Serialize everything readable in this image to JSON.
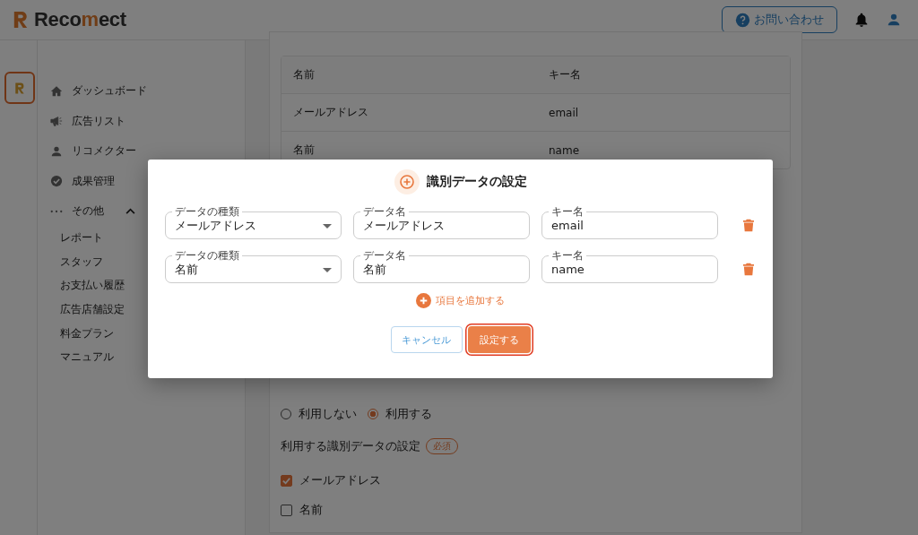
{
  "header": {
    "logo": {
      "before": "Reco",
      "accent": "m",
      "after": "ect"
    },
    "contact_button": "お問い合わせ"
  },
  "sidebar": {
    "items": [
      {
        "label": "ダッシュボード",
        "kind": "home"
      },
      {
        "label": "広告リスト",
        "kind": "megaphone"
      },
      {
        "label": "リコメクター",
        "kind": "person"
      },
      {
        "label": "成果管理",
        "kind": "check"
      },
      {
        "label": "その他",
        "kind": "more",
        "expanded": true,
        "children": [
          {
            "label": "レポート"
          },
          {
            "label": "スタッフ"
          },
          {
            "label": "お支払い履歴"
          },
          {
            "label": "広告店舗設定"
          },
          {
            "label": "料金プラン"
          },
          {
            "label": "マニュアル"
          }
        ]
      }
    ]
  },
  "list_table": {
    "columns": [
      "名前",
      "キー名"
    ],
    "rows": [
      [
        "メールアドレス",
        "email"
      ],
      [
        "名前",
        "name"
      ]
    ]
  },
  "auto_setting": {
    "options": [
      {
        "label": "利用しない",
        "selected": false
      },
      {
        "label": "利用する",
        "selected": true
      }
    ]
  },
  "data_setting": {
    "label": "利用する識別データの設定",
    "badge": "必須",
    "options": [
      {
        "label": "メールアドレス",
        "checked": true
      },
      {
        "label": "名前",
        "checked": false
      }
    ]
  },
  "modal": {
    "title": "識別データの設定",
    "rows": [
      {
        "type": {
          "label": "データの種類",
          "value": "メールアドレス"
        },
        "name": {
          "label": "データ名",
          "value": "メールアドレス"
        },
        "key": {
          "label": "キー名",
          "value": "email"
        }
      },
      {
        "type": {
          "label": "データの種類",
          "value": "名前"
        },
        "name": {
          "label": "データ名",
          "value": "名前"
        },
        "key": {
          "label": "キー名",
          "value": "name"
        }
      }
    ],
    "add_button": "項目を追加する",
    "cancel_button": "キャンセル",
    "confirm_button": "設定する"
  }
}
